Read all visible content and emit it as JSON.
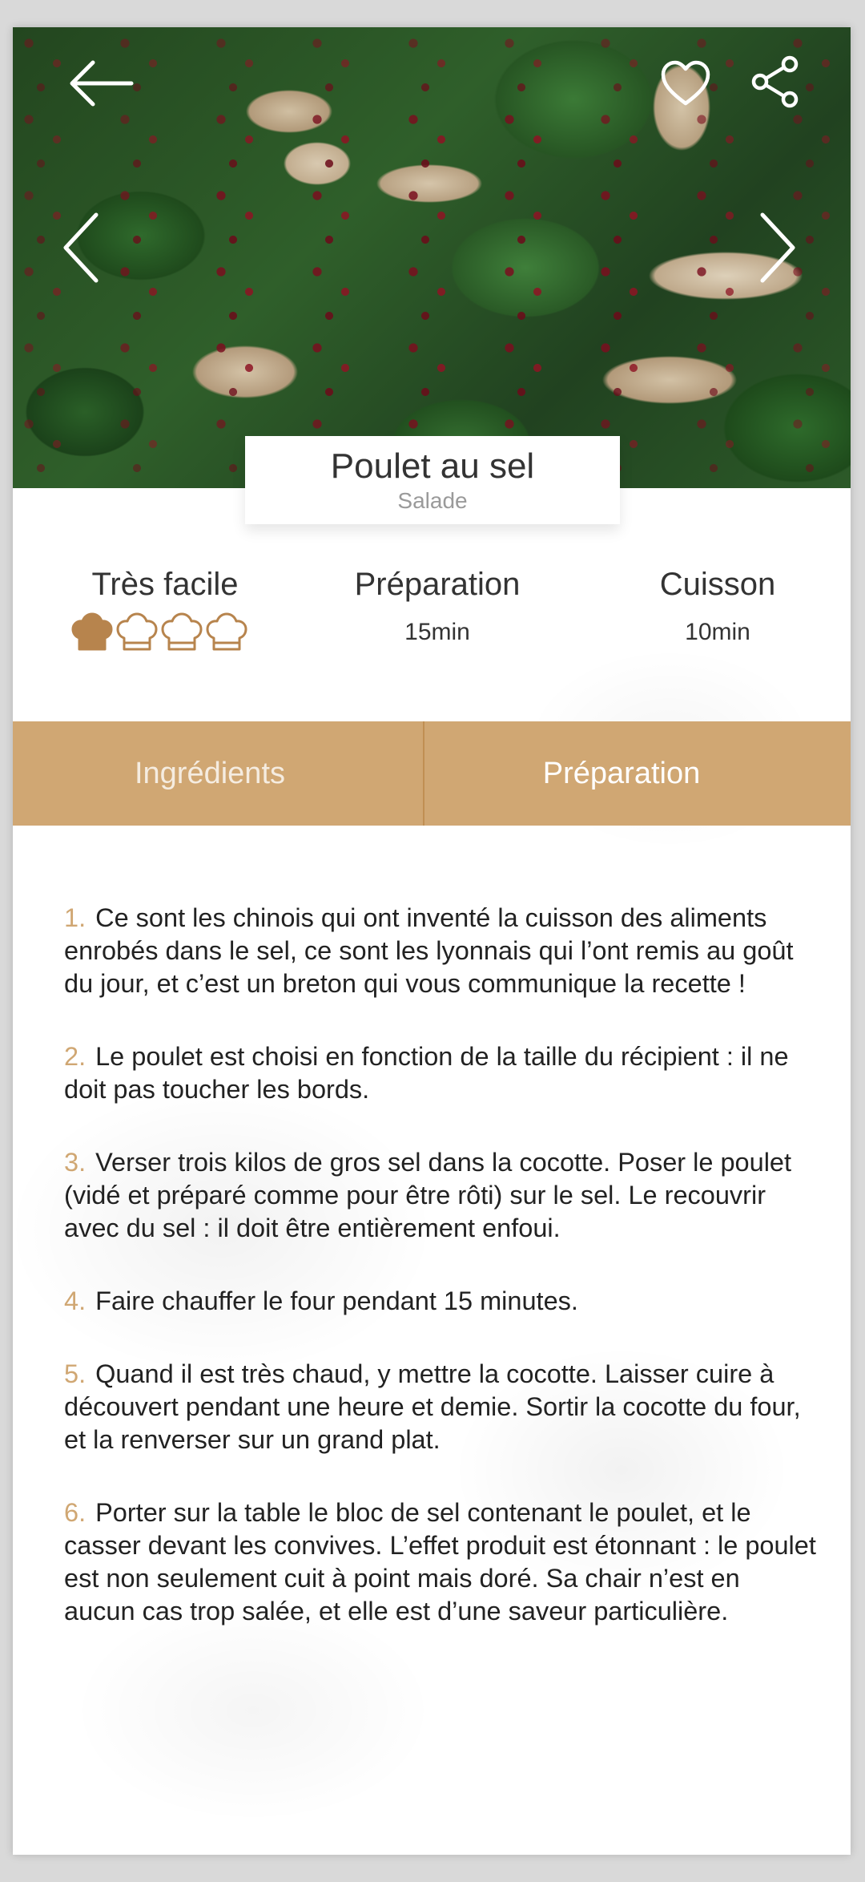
{
  "recipe": {
    "title": "Poulet au sel",
    "category": "Salade"
  },
  "info": {
    "difficulty_label": "Très facile",
    "difficulty_level": 1,
    "difficulty_max": 4,
    "preparation_label": "Préparation",
    "preparation_time": "15min",
    "cooking_label": "Cuisson",
    "cooking_time": "10min"
  },
  "tabs": {
    "ingredients": "Ingrédients",
    "preparation": "Préparation",
    "active": "preparation"
  },
  "steps": [
    {
      "num": "1.",
      "text": "Ce sont les chinois qui ont inventé la cuisson des aliments enrobés dans le sel, ce sont les lyonnais qui l’ont remis au goût du jour, et c’est un breton qui vous communique la recette !"
    },
    {
      "num": "2.",
      "text": "Le poulet est choisi en fonction de la taille du récipient : il ne doit pas toucher les bords."
    },
    {
      "num": "3.",
      "text": "Verser trois kilos de gros sel dans la cocotte. Poser le poulet (vidé et préparé comme pour être rôti) sur le sel. Le recouvrir avec du sel : il doit être entièrement enfoui."
    },
    {
      "num": "4.",
      "text": "Faire chauffer le four pendant 15 minutes."
    },
    {
      "num": "5.",
      "text": "Quand il est très chaud, y mettre la cocotte. Laisser cuire à découvert pendant une heure et demie. Sortir la cocotte du four, et la renverser sur un grand plat."
    },
    {
      "num": "6.",
      "text": "Porter sur la table le bloc de sel contenant le poulet, et le casser devant les convives. L’effet produit est étonnant : le poulet est non seulement cuit à point mais doré. Sa chair n’est en aucun cas trop salée, et elle est d’une saveur particulière."
    }
  ],
  "icons": {
    "back": "arrow-left-icon",
    "favorite": "heart-icon",
    "share": "share-icon",
    "prev": "chevron-left-icon",
    "next": "chevron-right-icon",
    "difficulty": "chef-hat-icon"
  },
  "colors": {
    "accent": "#d0a773",
    "text": "#222222",
    "subtitle": "#9a9a9a"
  }
}
